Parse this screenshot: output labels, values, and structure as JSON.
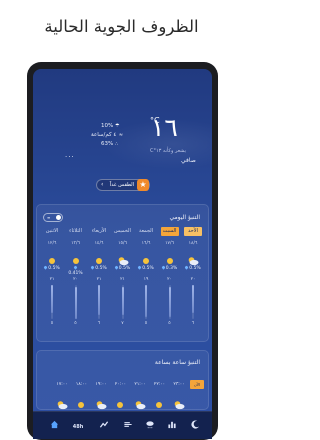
{
  "promo": {
    "title": "الظروف الجوية الحالية"
  },
  "current": {
    "temperature": "١٦",
    "unit": "°C",
    "feels_like": "يشعر وكأنه ١٣°C",
    "condition": "صافي",
    "stats": [
      {
        "icon": "umbrella-icon",
        "value": "10%"
      },
      {
        "icon": "wind-icon",
        "value": "٤ كم/ساعة"
      },
      {
        "icon": "humidity-icon",
        "value": "63%"
      }
    ],
    "ellipsis": "..."
  },
  "tomorrow": {
    "label": "الطقس غداً"
  },
  "daily": {
    "title": "التنبؤ اليومي",
    "days": [
      {
        "name": "الأحد",
        "date": "١٨/٦",
        "precip": "0.5%",
        "icon": "cloud-sun-icon",
        "hi": "٢٠",
        "lo": "٦",
        "active": true
      },
      {
        "name": "السبت",
        "date": "١٧/٦",
        "precip": "0.3%",
        "icon": "sun-icon",
        "hi": "٢٠",
        "lo": "٥",
        "active": true
      },
      {
        "name": "الجمعة",
        "date": "١٦/٦",
        "precip": "0.5%",
        "icon": "sun-icon",
        "hi": "١٩",
        "lo": "٥",
        "active": false
      },
      {
        "name": "الخميس",
        "date": "١٥/٦",
        "precip": "0.5%",
        "icon": "cloud-sun-icon",
        "hi": "٢١",
        "lo": "٧",
        "active": false
      },
      {
        "name": "الأربعاء",
        "date": "١٤/٦",
        "precip": "0.5%",
        "icon": "sun-icon",
        "hi": "٢١",
        "lo": "٦",
        "active": false
      },
      {
        "name": "الثلاثاء",
        "date": "١٣/٦",
        "precip": "0.41%",
        "icon": "sun-icon",
        "hi": "٢٠",
        "lo": "٥",
        "active": false
      },
      {
        "name": "الاثنين",
        "date": "١٢/٦",
        "precip": "0.5%",
        "icon": "sun-icon",
        "hi": "٢١",
        "lo": "٥",
        "active": false
      }
    ]
  },
  "hourly": {
    "title": "التنبؤ ساعة بساعة",
    "now_label": "الآن",
    "times": [
      "٢٣:٠٠",
      "٢٢:٠٠",
      "٢١:٠٠",
      "٢٠:٠٠",
      "١٩:٠٠",
      "١٨:٠٠",
      "١٧:٠٠"
    ]
  },
  "nav": {
    "items": [
      {
        "icon": "home-icon",
        "label": ""
      },
      {
        "icon": "48h-icon",
        "label": "48h"
      },
      {
        "icon": "chart-icon",
        "label": ""
      },
      {
        "icon": "wind-nav-icon",
        "label": ""
      },
      {
        "icon": "precip-nav-icon",
        "label": ""
      },
      {
        "icon": "bars-icon",
        "label": ""
      },
      {
        "icon": "moon-icon",
        "label": ""
      }
    ]
  },
  "colors": {
    "accent": "#f4a53a",
    "screen_bg": "#2a4a98",
    "nav_active": "#58a3ff"
  }
}
